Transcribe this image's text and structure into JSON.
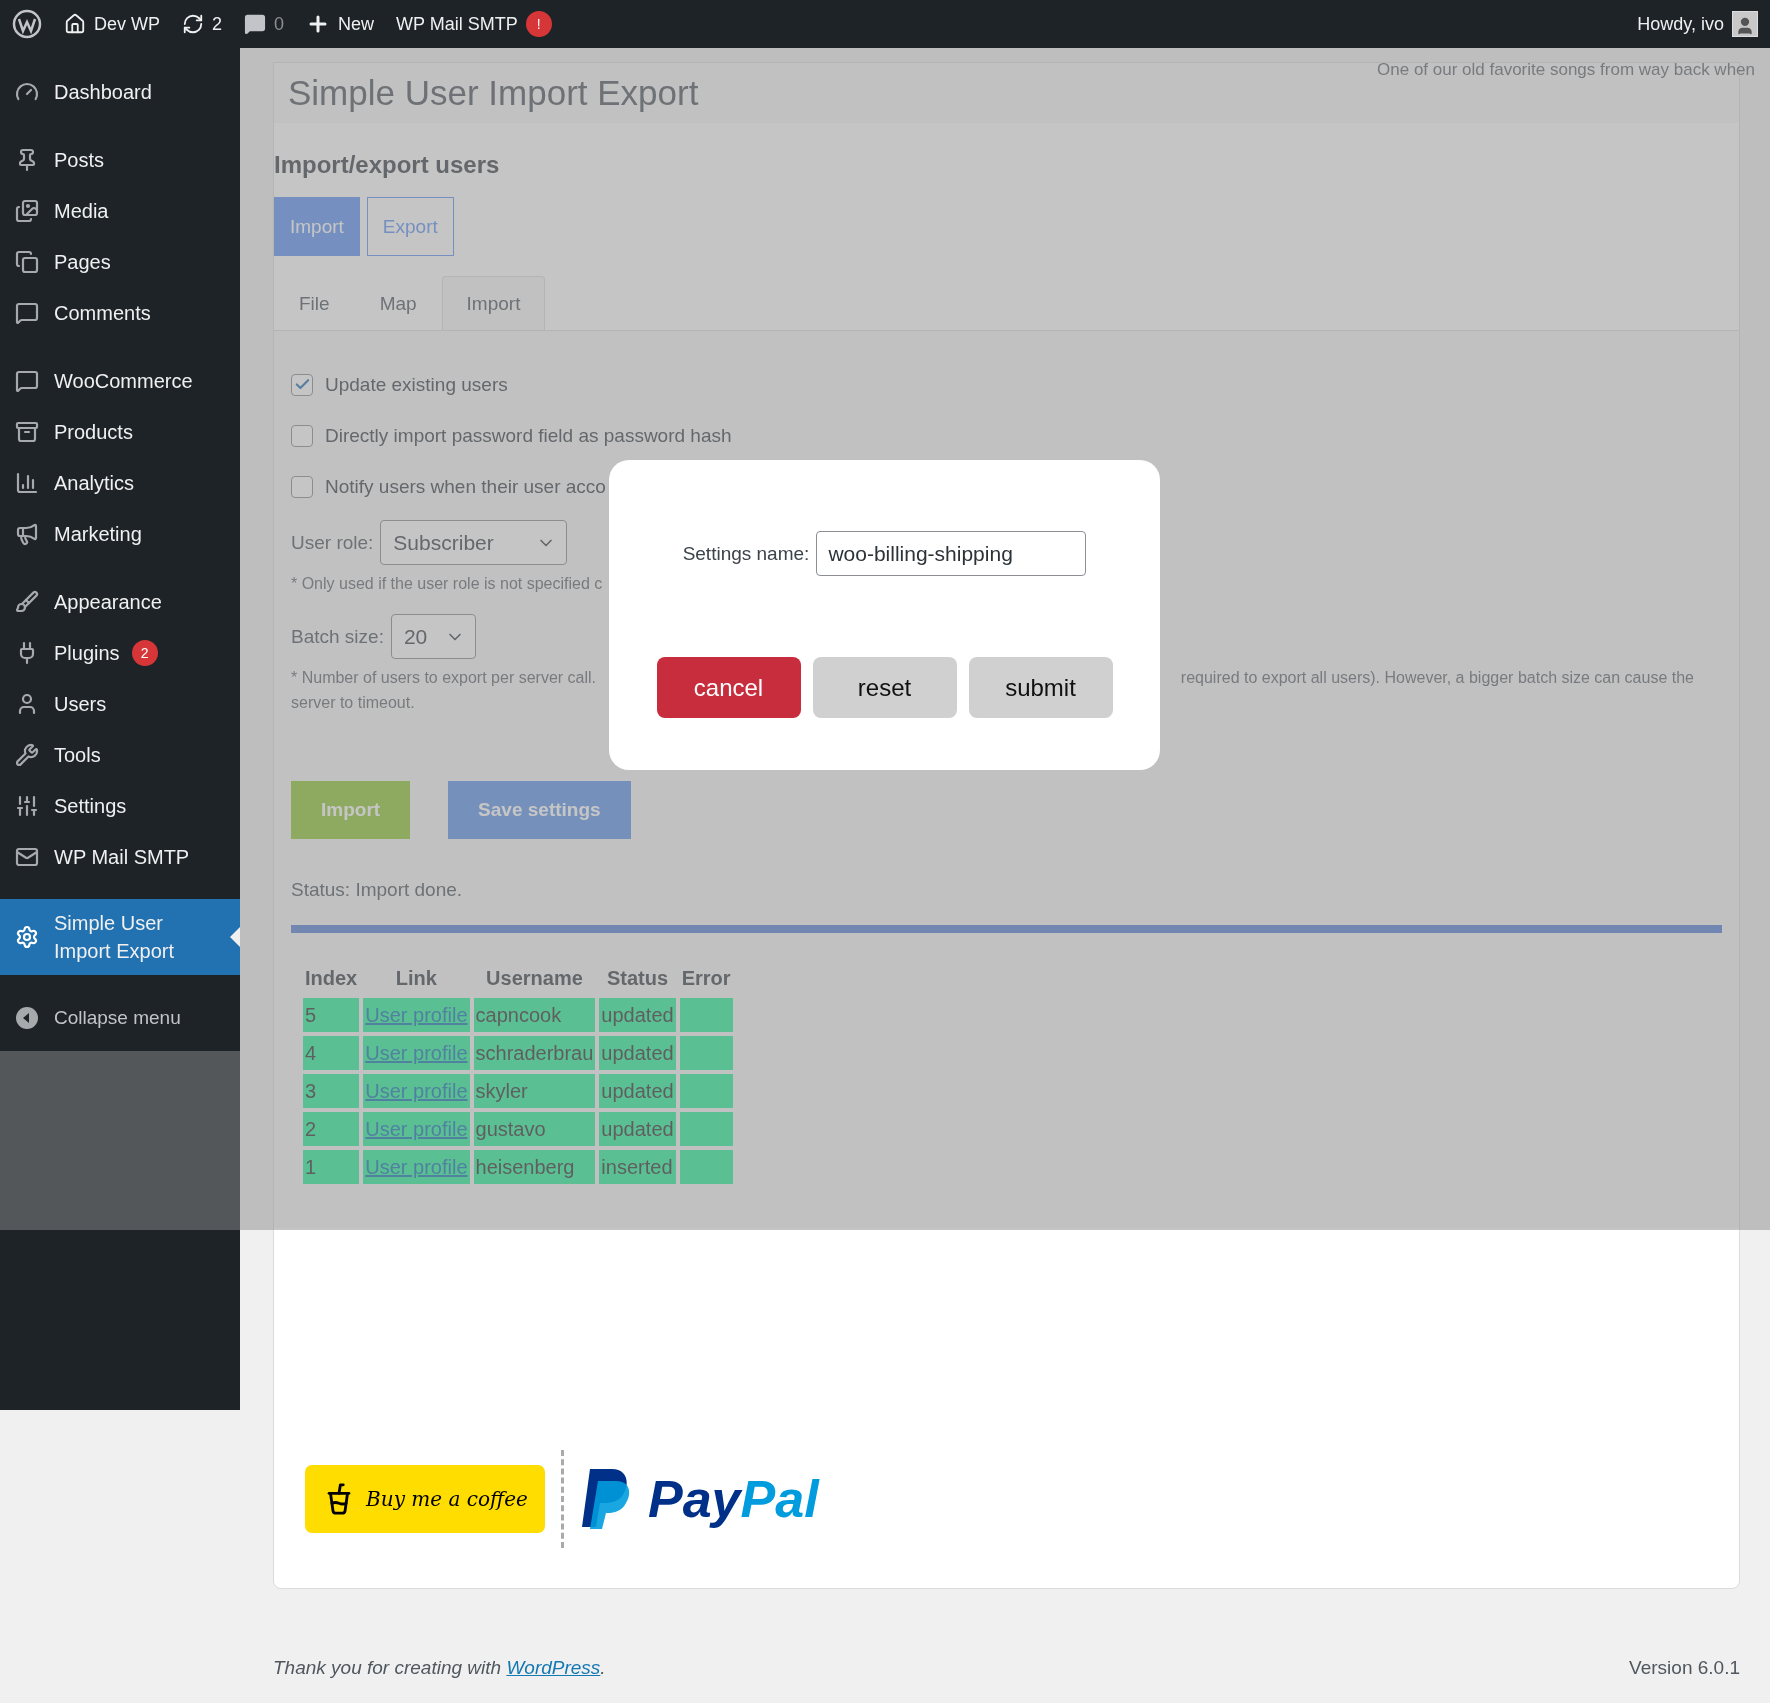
{
  "admin_bar": {
    "site": "Dev WP",
    "updates": "2",
    "comments": "0",
    "new": "New",
    "plugin": "WP Mail SMTP",
    "plugin_badge": "!",
    "howdy": "Howdy, ivo"
  },
  "sidebar": {
    "groups": [
      [
        {
          "label": "Dashboard",
          "selected": false
        }
      ],
      [
        {
          "label": "Posts",
          "selected": false
        },
        {
          "label": "Media",
          "selected": false
        },
        {
          "label": "Pages",
          "selected": false
        },
        {
          "label": "Comments",
          "selected": false
        }
      ],
      [
        {
          "label": "WooCommerce",
          "selected": false
        },
        {
          "label": "Products",
          "selected": false
        },
        {
          "label": "Analytics",
          "selected": false
        },
        {
          "label": "Marketing",
          "selected": false
        }
      ],
      [
        {
          "label": "Appearance",
          "selected": false
        },
        {
          "label": "Plugins",
          "badge": "2",
          "selected": false
        },
        {
          "label": "Users",
          "selected": false
        },
        {
          "label": "Tools",
          "selected": false
        },
        {
          "label": "Settings",
          "selected": false
        },
        {
          "label": "WP Mail SMTP",
          "selected": false
        }
      ],
      [
        {
          "label": "Simple User Import Export",
          "selected": true
        }
      ]
    ],
    "collapse": "Collapse menu"
  },
  "page": {
    "title": "Simple User Import Export",
    "tagline": "One of our old favorite songs from way back when",
    "heading": "Import/export users",
    "modes": [
      {
        "label": "Import",
        "selected": true
      },
      {
        "label": "Export",
        "selected": false
      }
    ],
    "tabs": [
      {
        "label": "File",
        "selected": false
      },
      {
        "label": "Map",
        "selected": false
      },
      {
        "label": "Import",
        "selected": true
      }
    ],
    "options": [
      {
        "label": "Update existing users",
        "checked": true
      },
      {
        "label": "Directly import password field as password hash",
        "checked": false
      },
      {
        "label": "Notify users when their user acco",
        "checked": false
      }
    ],
    "user_role": {
      "label": "User role:",
      "value": "Subscriber",
      "note": "* Only used if the user role is not specified c"
    },
    "batch_size": {
      "label": "Batch size:",
      "value": "20",
      "note_left": "* Number of users to export per server call.",
      "note_right": "required to export all users). However, a bigger batch size can cause the",
      "note_line2": "server to timeout."
    },
    "actions": [
      {
        "label": "Import",
        "kind": "import"
      },
      {
        "label": "Save settings",
        "kind": "save"
      }
    ],
    "status": "Status: Import done.",
    "progress": {
      "level": 1
    },
    "table": {
      "columns": [
        "Index",
        "Link",
        "Username",
        "Status",
        "Error"
      ],
      "rows": [
        {
          "index": "5",
          "link": "User profile",
          "username": "capncook",
          "status": "updated",
          "error": ""
        },
        {
          "index": "4",
          "link": "User profile",
          "username": "schraderbrau",
          "status": "updated",
          "error": ""
        },
        {
          "index": "3",
          "link": "User profile",
          "username": "skyler",
          "status": "updated",
          "error": ""
        },
        {
          "index": "2",
          "link": "User profile",
          "username": "gustavo",
          "status": "updated",
          "error": ""
        },
        {
          "index": "1",
          "link": "User profile",
          "username": "heisenberg",
          "status": "inserted",
          "error": ""
        }
      ]
    },
    "donate": {
      "coffee": "Buy me a coffee",
      "paypal_a": "Pay",
      "paypal_b": "Pal"
    }
  },
  "dialog": {
    "label": "Settings name:",
    "value": "woo-billing-shipping",
    "buttons": [
      {
        "label": "cancel",
        "kind": "danger"
      },
      {
        "label": "reset",
        "kind": "plain"
      },
      {
        "label": "submit",
        "kind": "plain"
      }
    ]
  },
  "footer": {
    "text": "Thank you for creating with ",
    "link": "WordPress",
    "after": ".",
    "version": "Version 6.0.1"
  }
}
